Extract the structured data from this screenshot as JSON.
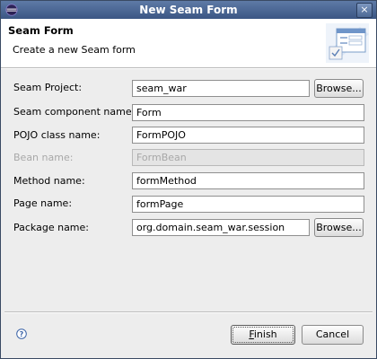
{
  "window": {
    "title": "New Seam Form",
    "close_glyph": "×"
  },
  "header": {
    "title": "Seam Form",
    "description": "Create a new Seam form"
  },
  "form": {
    "project_label": "Seam Project:",
    "project_value": "seam_war",
    "component_label": "Seam component name:",
    "component_value": "Form",
    "pojo_label": "POJO class name:",
    "pojo_value": "FormPOJO",
    "bean_label": "Bean name:",
    "bean_value": "FormBean",
    "method_label": "Method name:",
    "method_value": "formMethod",
    "page_label": "Page name:",
    "page_value": "formPage",
    "package_label": "Package name:",
    "package_value": "org.domain.seam_war.session",
    "browse_label": "Browse..."
  },
  "footer": {
    "finish_first": "F",
    "finish_rest": "inish",
    "cancel_label": "Cancel"
  },
  "icons": {
    "app": "eclipse-icon",
    "help": "help-icon",
    "banner": "form-wizard-banner-icon"
  }
}
